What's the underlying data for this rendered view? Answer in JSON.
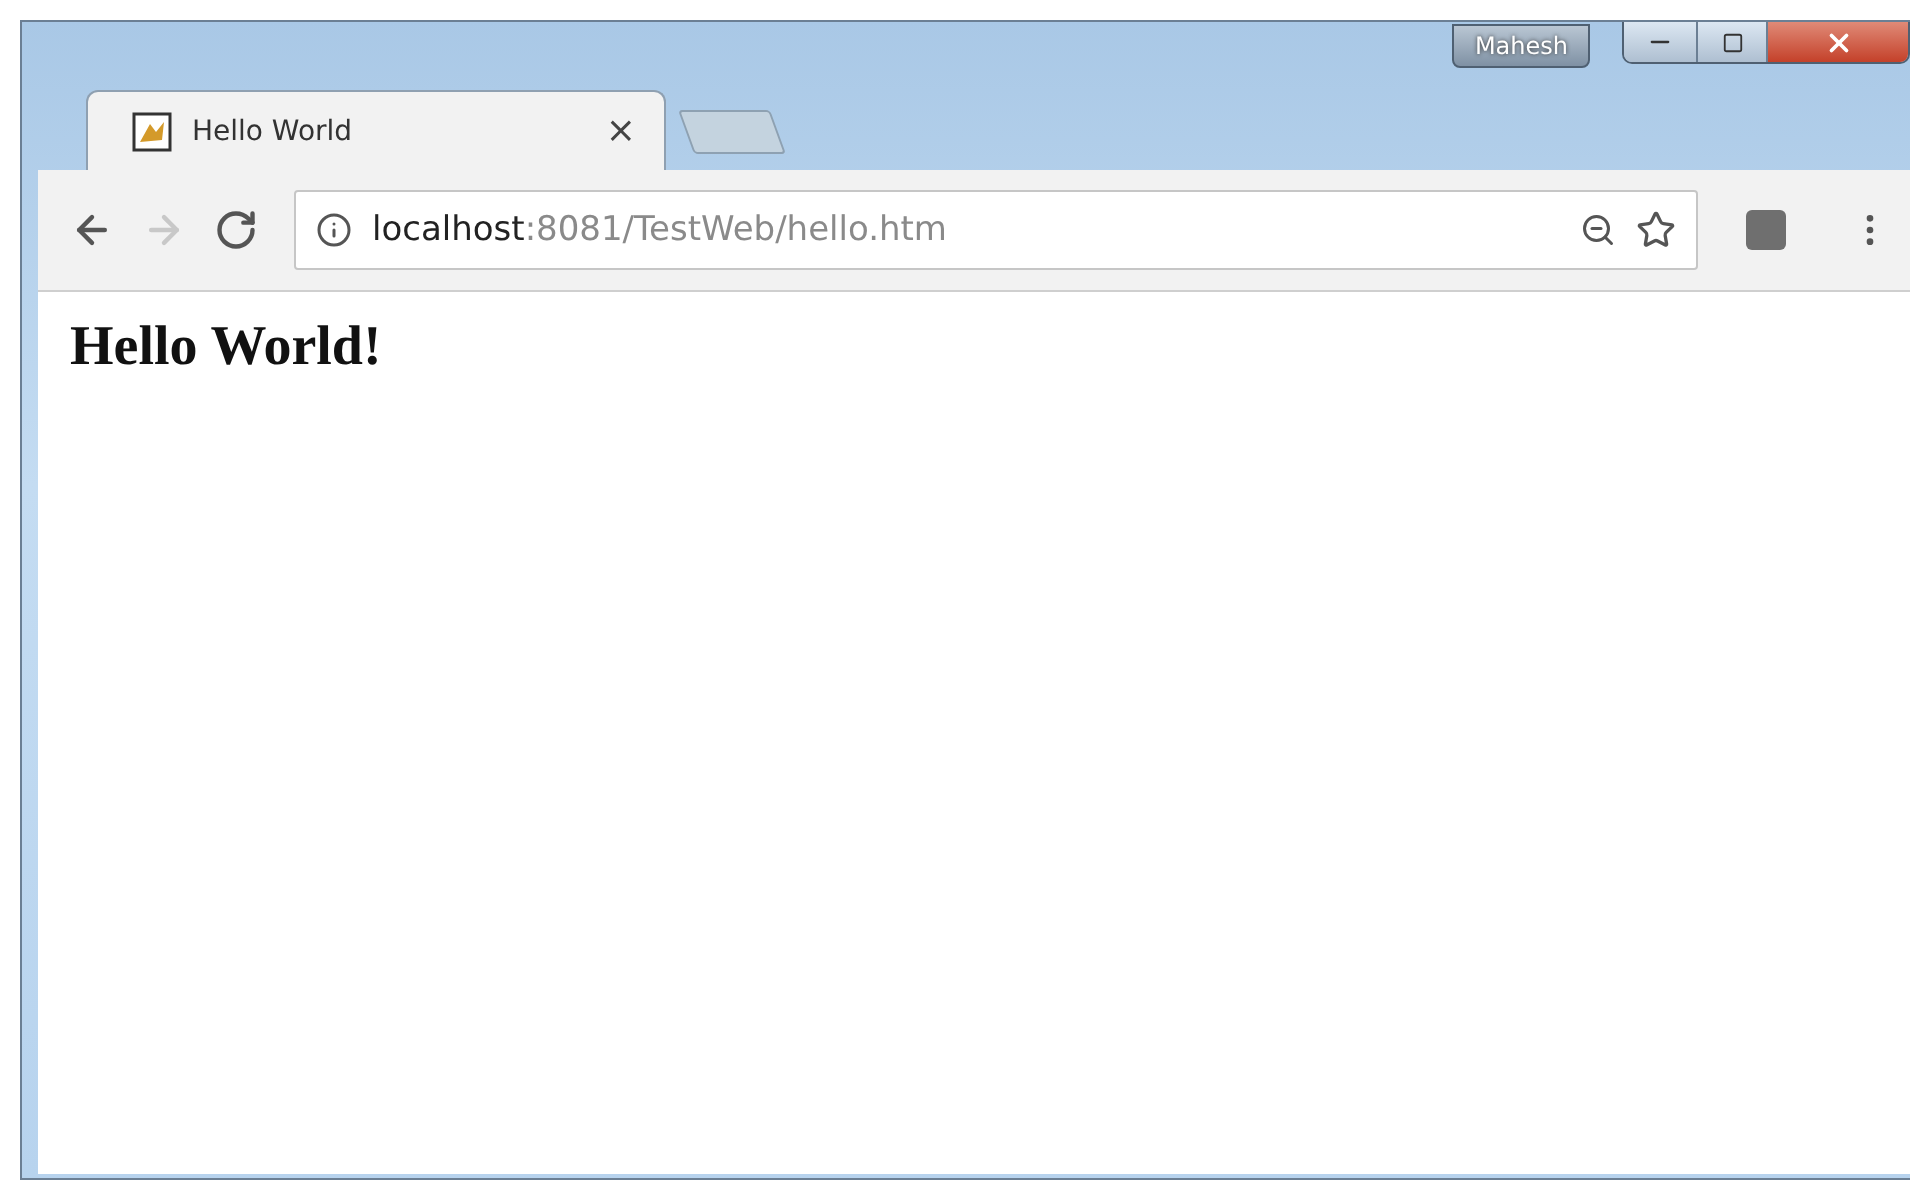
{
  "window": {
    "user": "Mahesh"
  },
  "tabs": [
    {
      "title": "Hello World",
      "close": "×",
      "selected": true
    }
  ],
  "toolbar": {
    "nav": [
      {
        "kind": "back",
        "disabled": false
      },
      {
        "kind": "forward",
        "disabled": true
      },
      {
        "kind": "reload",
        "disabled": false
      }
    ],
    "address": {
      "host": "localhost",
      "rest": ":8081/TestWeb/hello.htm"
    }
  },
  "page": {
    "heading": "Hello World!"
  }
}
